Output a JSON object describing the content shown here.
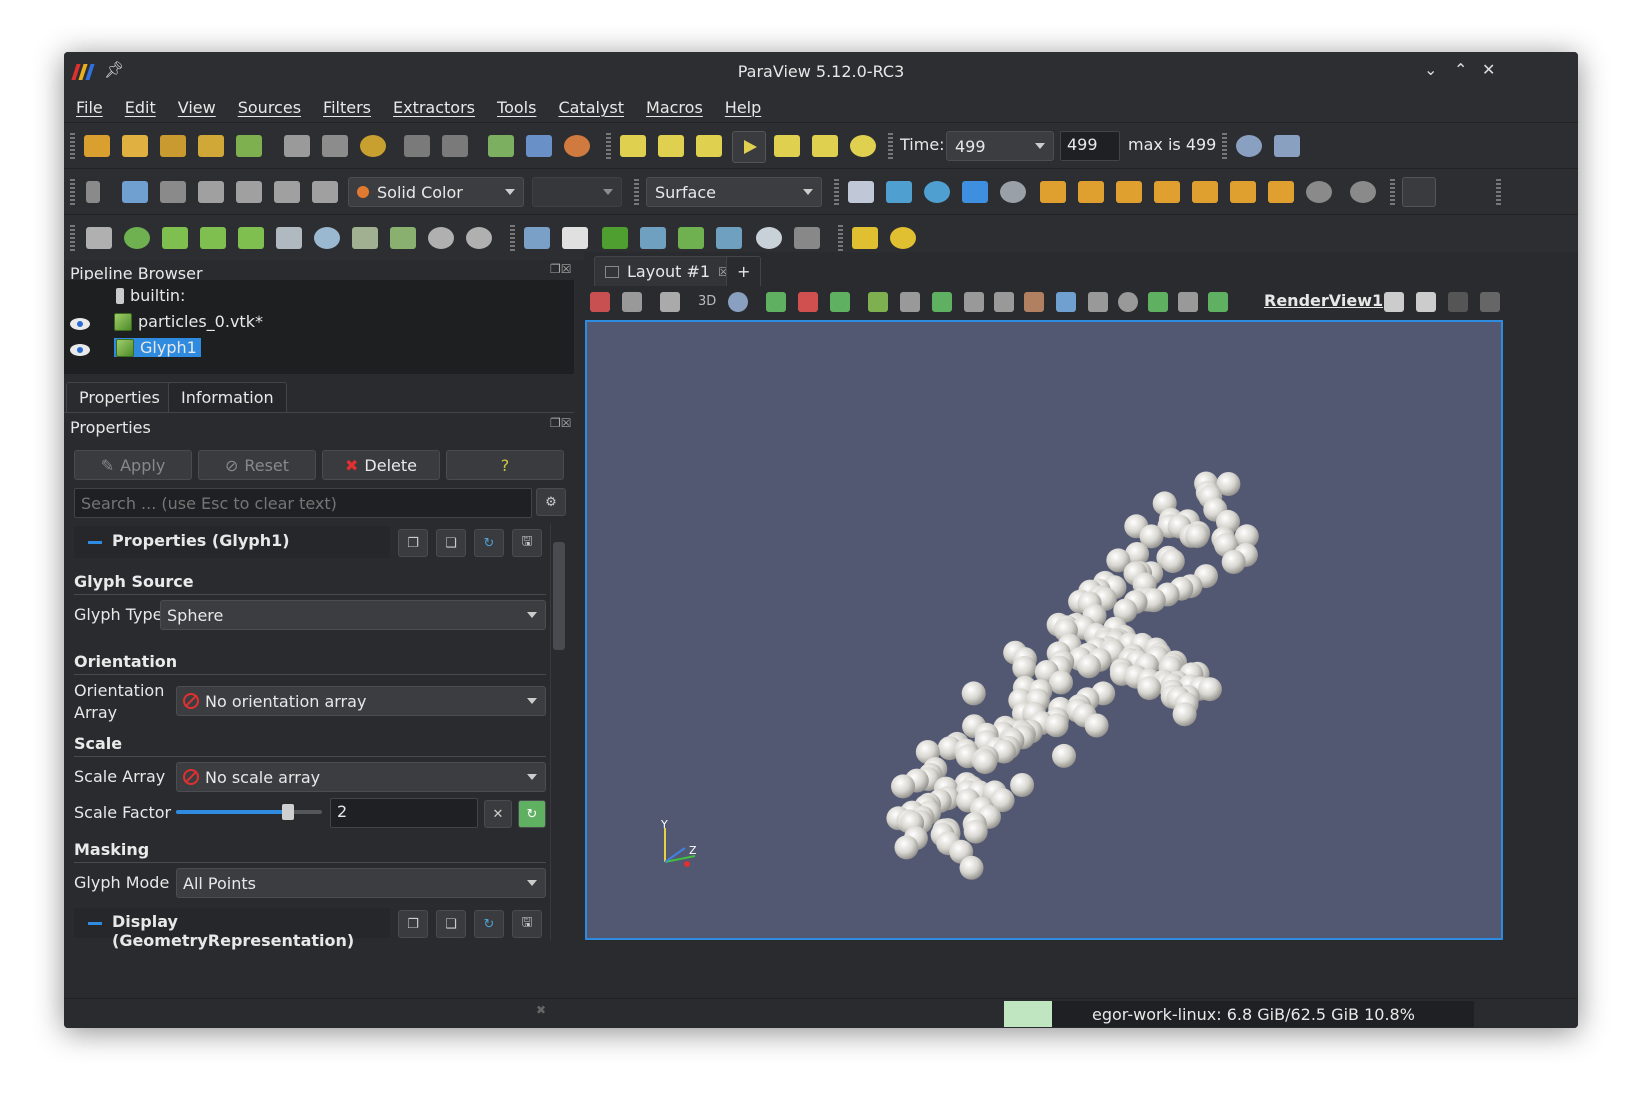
{
  "window": {
    "title": "ParaView 5.12.0-RC3"
  },
  "menu": [
    "File",
    "Edit",
    "View",
    "Sources",
    "Filters",
    "Extractors",
    "Tools",
    "Catalyst",
    "Macros",
    "Help"
  ],
  "time": {
    "label": "Time:",
    "value": "499",
    "step": "499",
    "max_text": "max is 499"
  },
  "toolbar2": {
    "coloring": "Solid Color",
    "component": "",
    "representation": "Surface"
  },
  "pipeline": {
    "title": "Pipeline Browser",
    "items": [
      {
        "label": "builtin:"
      },
      {
        "label": "particles_0.vtk*"
      },
      {
        "label": "Glyph1"
      }
    ]
  },
  "tabs": {
    "properties": "Properties",
    "information": "Information"
  },
  "properties": {
    "title": "Properties",
    "apply": "Apply",
    "reset": "Reset",
    "delete": "Delete",
    "help": "?",
    "search_placeholder": "Search ... (use Esc to clear text)",
    "group_header": "Properties (Glyph1)",
    "glyph_source": "Glyph Source",
    "glyph_type_label": "Glyph Type",
    "glyph_type_value": "Sphere",
    "orientation": "Orientation",
    "orientation_array_label_1": "Orientation",
    "orientation_array_label_2": "Array",
    "orientation_array_value": "No orientation array",
    "scale": "Scale",
    "scale_array_label": "Scale Array",
    "scale_array_value": "No scale array",
    "scale_factor_label": "Scale Factor",
    "scale_factor_value": "2",
    "masking": "Masking",
    "glyph_mode_label": "Glyph Mode",
    "glyph_mode_value": "All Points",
    "display_header": "Display (GeometryRepresentation)"
  },
  "layout": {
    "tab": "Layout #1",
    "add": "+",
    "view_name": "RenderView1",
    "mode_3d": "3D"
  },
  "axes": {
    "y": "Y",
    "z": "Z"
  },
  "status": {
    "memory": "egor-work-linux: 6.8 GiB/62.5 GiB 10.8%"
  },
  "colors": {
    "accent": "#2f8be0",
    "background": "#525772",
    "selection": "#2f8be0"
  }
}
